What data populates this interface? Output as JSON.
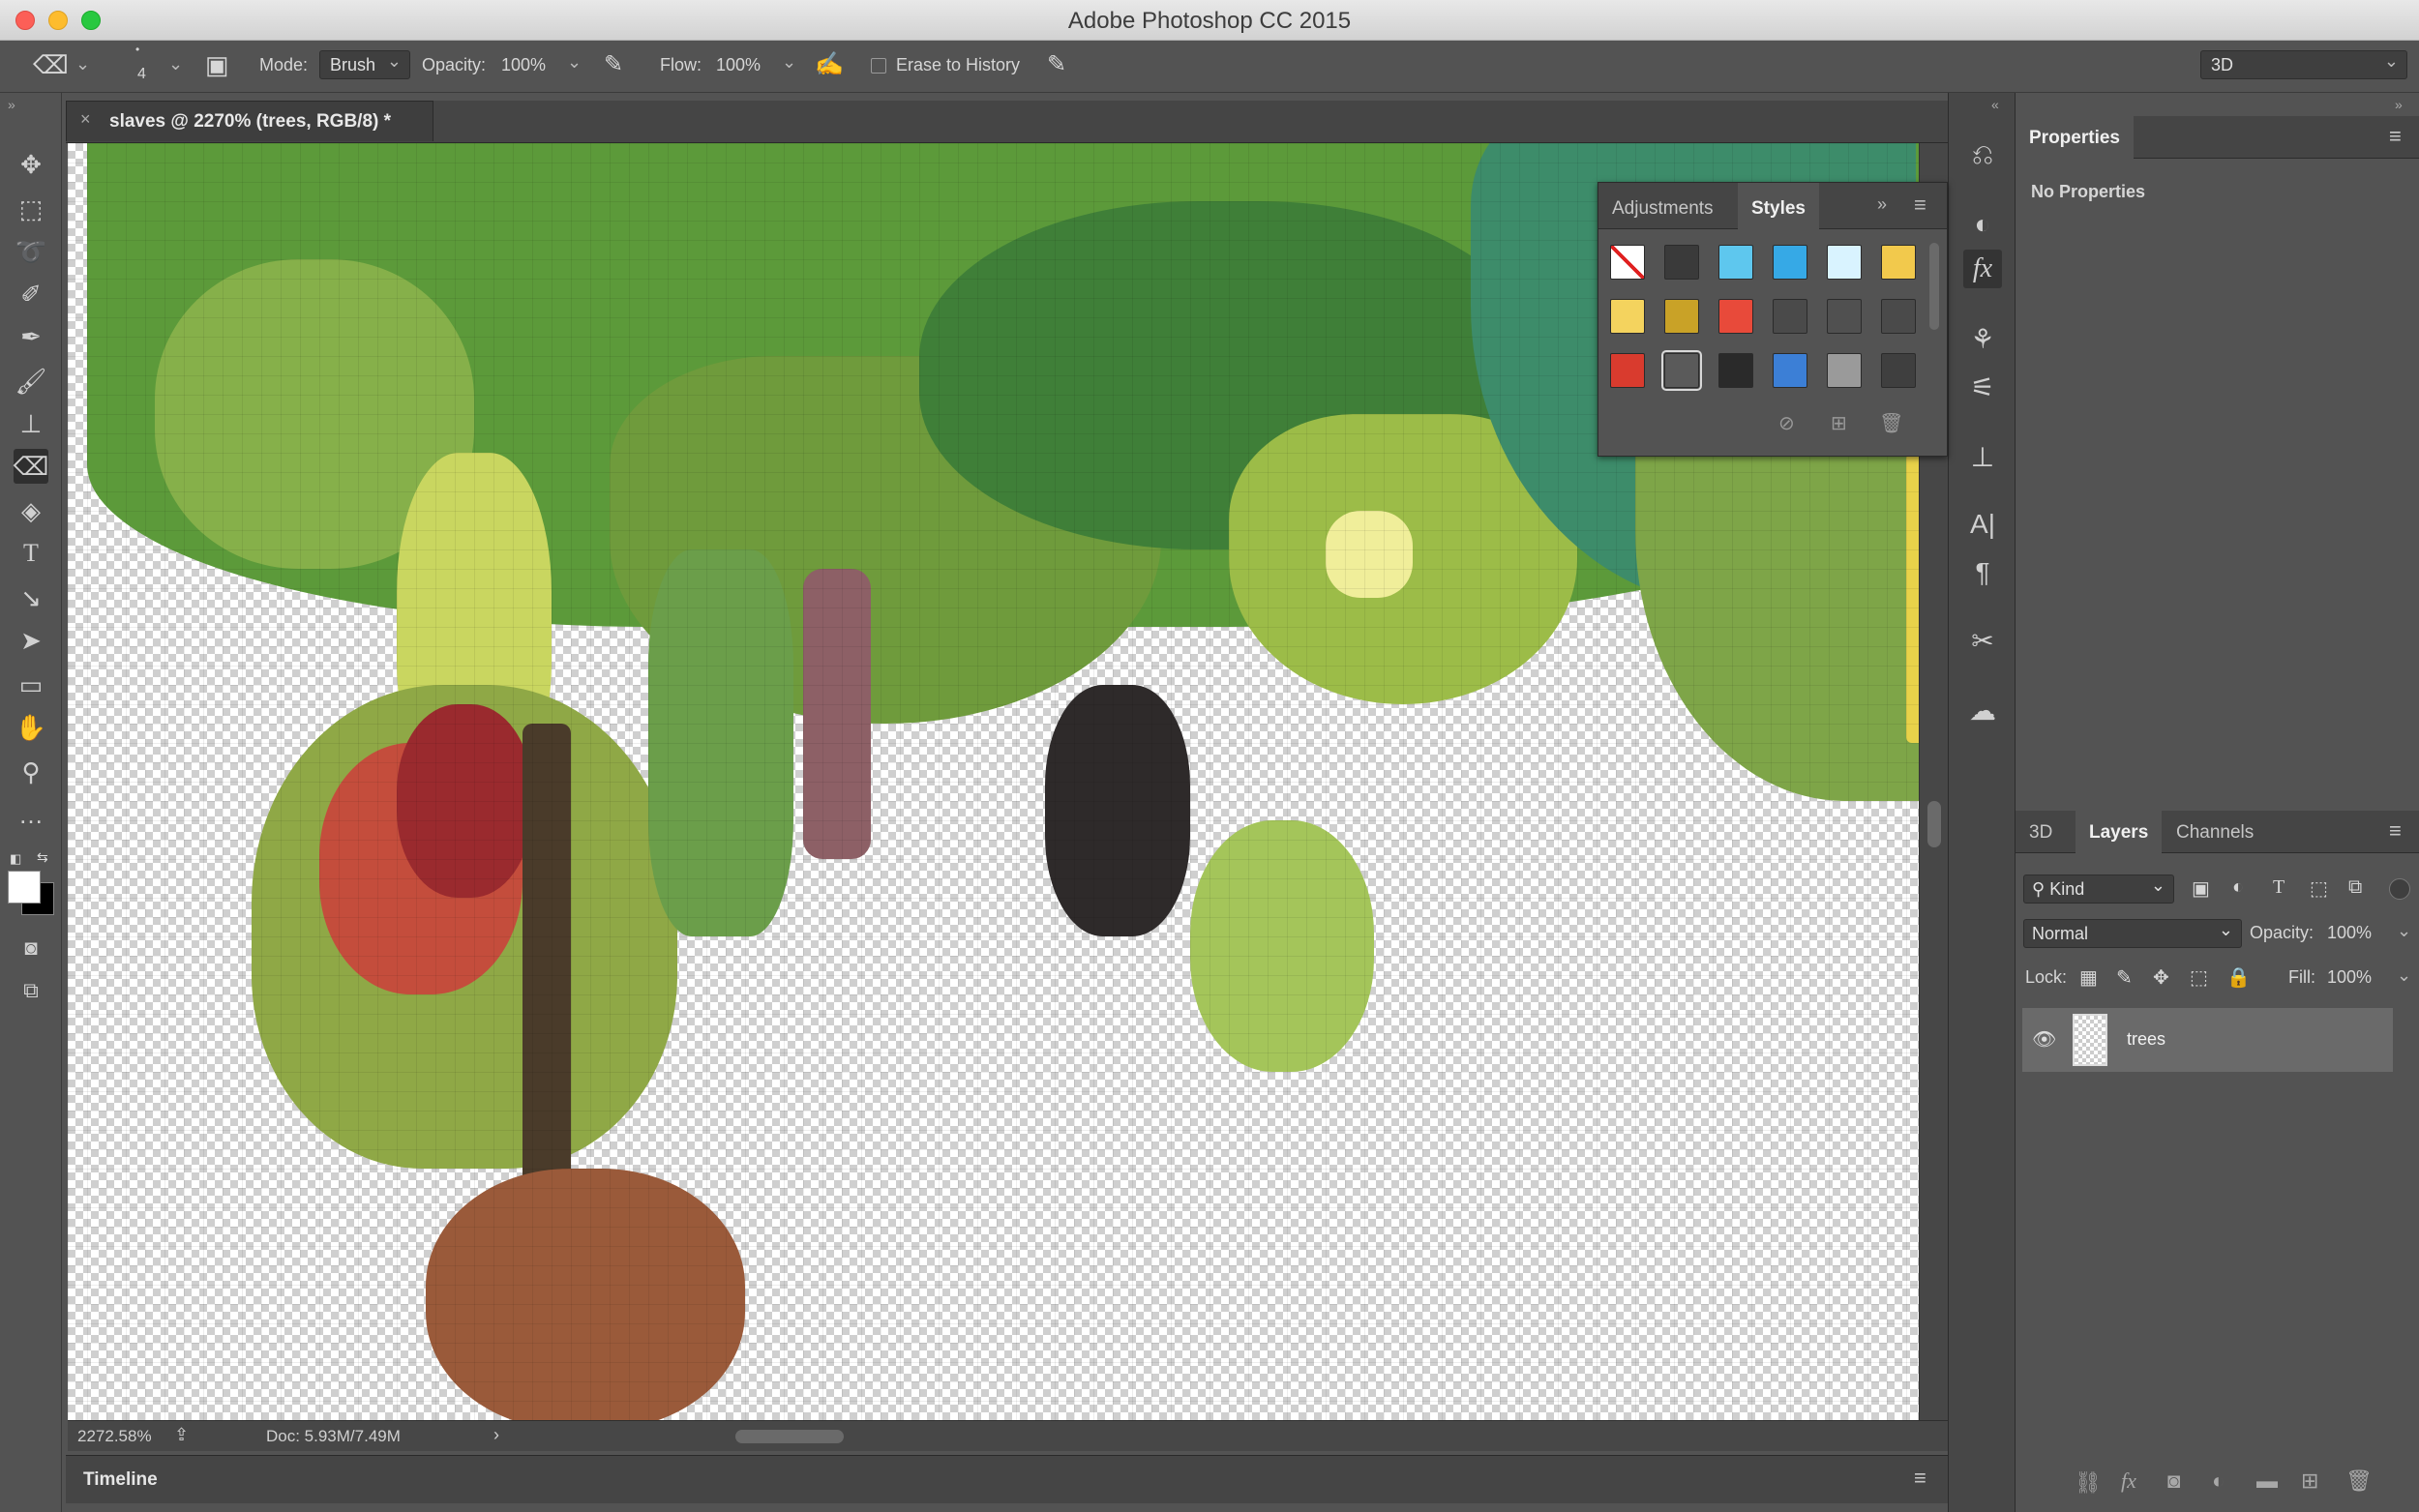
{
  "window": {
    "title": "Adobe Photoshop CC 2015"
  },
  "options_bar": {
    "brush_size": "4",
    "mode_label": "Mode:",
    "mode_value": "Brush",
    "opacity_label": "Opacity:",
    "opacity_value": "100%",
    "flow_label": "Flow:",
    "flow_value": "100%",
    "erase_history_label": "Erase to History",
    "workspace_value": "3D"
  },
  "document": {
    "tab_title": "slaves @ 2270% (trees, RGB/8) *",
    "zoom_status": "2272.58%",
    "doc_status": "Doc: 5.93M/7.49M"
  },
  "timeline": {
    "label": "Timeline"
  },
  "styles_panel": {
    "tabs": [
      "Adjustments",
      "Styles"
    ],
    "active_tab": "Styles",
    "swatches": [
      "#ffffff",
      "#3a3a3a",
      "#5ec7ee",
      "#36a9e6",
      "#d9f3ff",
      "#f2c94c",
      "#f4d35e",
      "#c9a227",
      "#e84a3a",
      "#4a4a4a",
      "#505050",
      "#4a4a4a",
      "#d93b2e",
      "#5a5a5a",
      "#2a2a2a",
      "#3c7fd6",
      "#9a9a9a",
      "#3f3f3f"
    ]
  },
  "properties_panel": {
    "tab": "Properties",
    "empty_text": "No Properties"
  },
  "layers_panel": {
    "tabs": [
      "3D",
      "Layers",
      "Channels"
    ],
    "active_tab": "Layers",
    "filter_value": "Kind",
    "blend_mode": "Normal",
    "opacity_label": "Opacity:",
    "opacity_value": "100%",
    "lock_label": "Lock:",
    "fill_label": "Fill:",
    "fill_value": "100%",
    "layers": [
      {
        "name": "trees",
        "visible": true
      }
    ]
  },
  "colors": {
    "accent_green": "#4a8a2e",
    "canvas_bg_dark": "#535353",
    "panel_dark": "#454545"
  }
}
